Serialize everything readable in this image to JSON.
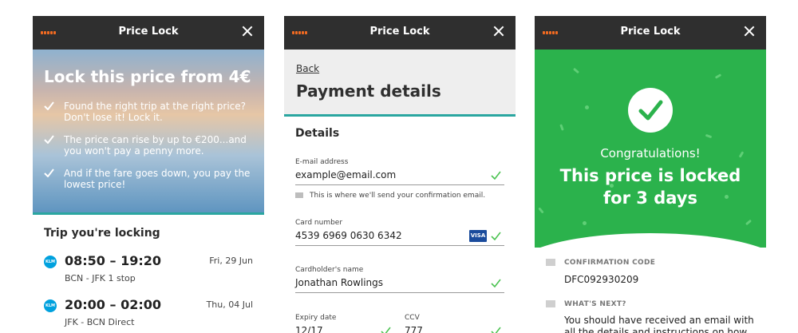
{
  "screen1": {
    "title": "Price Lock",
    "heading": "Lock this price from 4€",
    "bullets": [
      "Found the right trip at the right price? Don't lose it! Lock it.",
      "The price can rise by up to €200...and you won't pay a penny more.",
      "And if the fare goes down, you pay the lowest price!"
    ],
    "section_title": "Trip you're locking",
    "trips": [
      {
        "times": "08:50 – 19:20",
        "date": "Fri, 29 Jun",
        "route": "BCN - JFK   1 stop",
        "airline": "KLM"
      },
      {
        "times": "20:00 – 02:00",
        "date": "Thu, 04 Jul",
        "route": "JFK - BCN   Direct",
        "airline": "KLM"
      }
    ]
  },
  "screen2": {
    "title": "Price Lock",
    "back": "Back",
    "heading": "Payment details",
    "section_title": "Details",
    "email": {
      "label": "E-mail address",
      "value": "example@email.com",
      "hint": "This is where we'll send your confirmation email."
    },
    "card": {
      "label": "Card number",
      "value": "4539 6969 0630 6342",
      "brand": "VISA"
    },
    "holder": {
      "label": "Cardholder's name",
      "value": "Jonathan Rowlings"
    },
    "expiry": {
      "label": "Expiry date",
      "value": "12/17"
    },
    "ccv": {
      "label": "CCV",
      "value": "777"
    }
  },
  "screen3": {
    "title": "Price Lock",
    "congrats": "Congratulations!",
    "message_line1": "This price is locked",
    "message_line2": "for 3 days",
    "code_label": "CONFIRMATION CODE",
    "code_value": "DFC092930209",
    "next_label": "WHAT'S NEXT?",
    "next_line1": "You should have received an email with",
    "next_line2": "all the details and instructions on how"
  },
  "colors": {
    "accent": "#f26b21",
    "teal": "#2aa6a0",
    "green": "#2bb24c",
    "check": "#4cc352"
  }
}
